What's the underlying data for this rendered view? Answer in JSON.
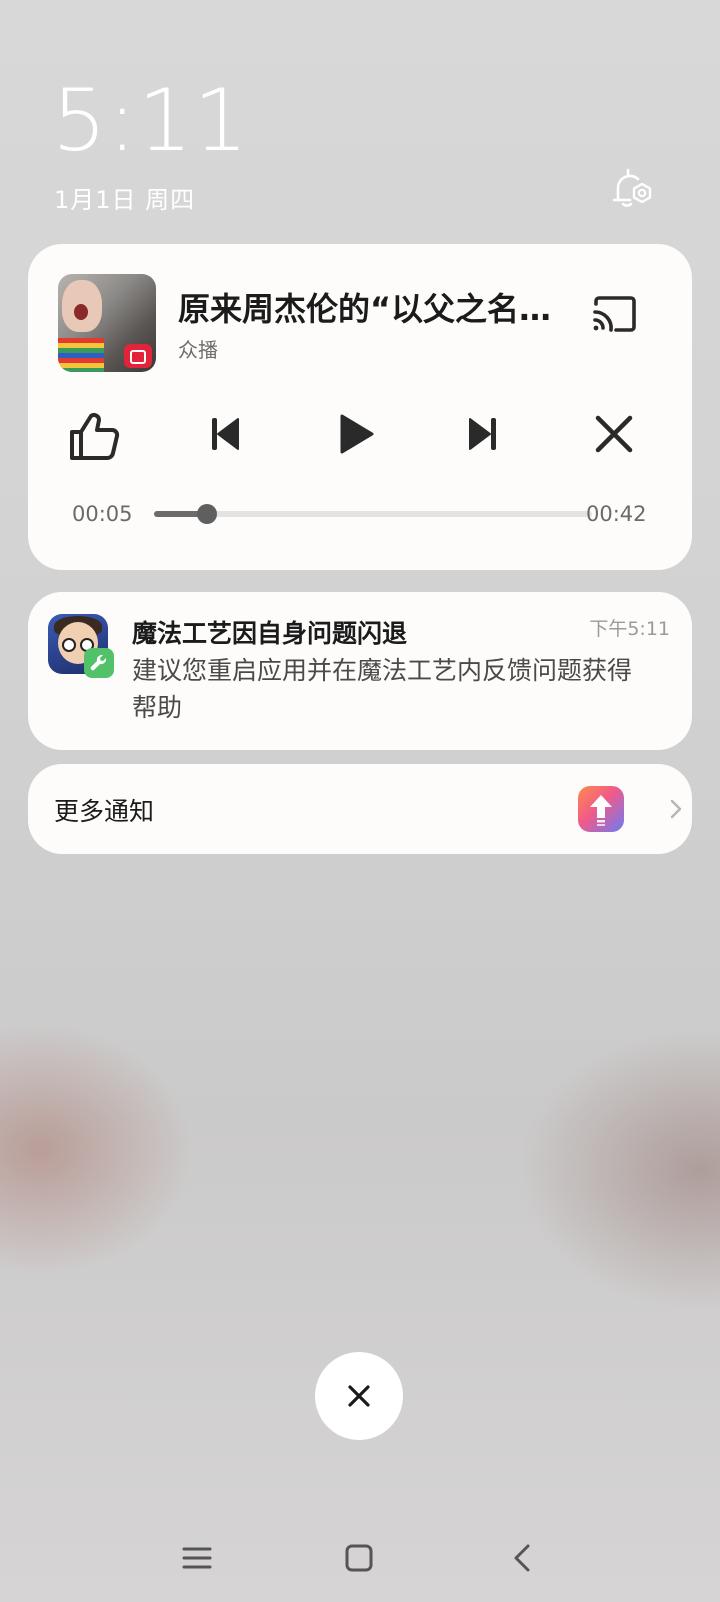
{
  "lockscreen": {
    "time": "5:11",
    "date": "1月1日 周四",
    "notification_settings_icon": "bell-settings-icon"
  },
  "media_player": {
    "title": "原来周杰伦的“以父之名…",
    "app_name": "众播",
    "cast_icon": "cast-icon",
    "controls": [
      "thumbs-up-icon",
      "skip-previous-icon",
      "play-icon",
      "skip-next-icon",
      "close-icon"
    ],
    "elapsed": "00:05",
    "duration": "00:42",
    "progress_fraction": 0.12
  },
  "notification": {
    "title": "魔法工艺因自身问题闪退",
    "time": "下午5:11",
    "body": "建议您重启应用并在魔法工艺内反馈问题获得帮助"
  },
  "more_notifications": {
    "label": "更多通知",
    "app_icon": "upload-app-icon",
    "chevron_icon": "chevron-right-icon"
  },
  "dismiss_button": {
    "icon": "close-icon"
  },
  "navbar": {
    "icons": [
      "menu-icon",
      "home-icon",
      "back-icon"
    ]
  },
  "colors": {
    "card_bg": "#fdfcfa",
    "wallpaper": "#cfcfcf",
    "progress_fill": "#6b6b6b",
    "badge_green": "#52c26a"
  }
}
